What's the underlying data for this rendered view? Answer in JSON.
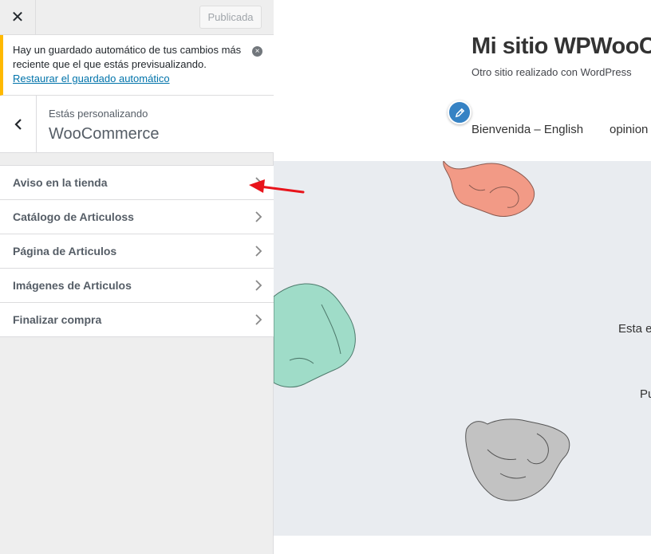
{
  "sidebar": {
    "close_icon": "x",
    "publish_label": "Publicada",
    "notice": {
      "text": "Hay un guardado automático de tus cambios más reciente que el que estás previsualizando.",
      "link": "Restaurar el guardado automático",
      "dismiss_icon": "×"
    },
    "section": {
      "customizing_label": "Estás personalizando",
      "title": "WooCommerce"
    },
    "items": [
      {
        "label": "Aviso en la tienda"
      },
      {
        "label": "Catálogo de Articuloss"
      },
      {
        "label": "Página de Articulos"
      },
      {
        "label": "Imágenes de Articulos"
      },
      {
        "label": "Finalizar compra"
      }
    ]
  },
  "preview": {
    "site_title": "Mi sitio WPWooCo",
    "tagline": "Otro sitio realizado con WordPress",
    "nav": [
      "Bienvenida – English",
      "opinion"
    ],
    "hero_text_1": "Esta e",
    "hero_text_2": "Pu"
  },
  "colors": {
    "accent": "#0073aa",
    "notice_border": "#ffb900",
    "arrow": "#e8141b",
    "edit_shortcut": "#3582c4",
    "hoodie_pink": "#f29a86",
    "hoodie_mint": "#9fdcc8",
    "hoodie_gray": "#c2c2c2"
  }
}
